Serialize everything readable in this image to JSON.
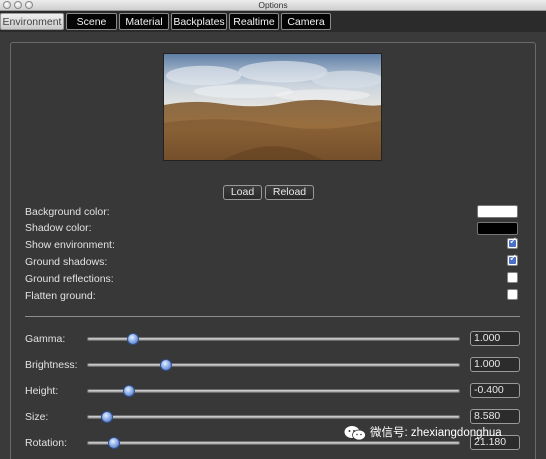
{
  "window": {
    "title": "Options"
  },
  "tabs": [
    {
      "label": "Environment",
      "active": true
    },
    {
      "label": "Scene",
      "active": false
    },
    {
      "label": "Material",
      "active": false
    },
    {
      "label": "Backplates",
      "active": false
    },
    {
      "label": "Realtime",
      "active": false
    },
    {
      "label": "Camera",
      "active": false
    }
  ],
  "buttons": {
    "load": "Load",
    "reload": "Reload"
  },
  "settings": {
    "background_color": {
      "label": "Background color:",
      "value": "#ffffff"
    },
    "shadow_color": {
      "label": "Shadow color:",
      "value": "#000000"
    },
    "show_environment": {
      "label": "Show environment:",
      "checked": true
    },
    "ground_shadows": {
      "label": "Ground shadows:",
      "checked": true
    },
    "ground_reflections": {
      "label": "Ground reflections:",
      "checked": false
    },
    "flatten_ground": {
      "label": "Flatten ground:",
      "checked": false
    }
  },
  "sliders": [
    {
      "label": "Gamma:",
      "value": "1.000",
      "fraction": 0.12
    },
    {
      "label": "Brightness:",
      "value": "1.000",
      "fraction": 0.21
    },
    {
      "label": "Height:",
      "value": "-0.400",
      "fraction": 0.11
    },
    {
      "label": "Size:",
      "value": "8.580",
      "fraction": 0.05
    },
    {
      "label": "Rotation:",
      "value": "21.180",
      "fraction": 0.07
    }
  ],
  "watermark": {
    "text": "微信号: zhexiangdonghua"
  },
  "colors": {
    "accent": "#4a6fc7",
    "tab_active_bg": "#dcdcdc",
    "panel_bg": "#383838"
  }
}
